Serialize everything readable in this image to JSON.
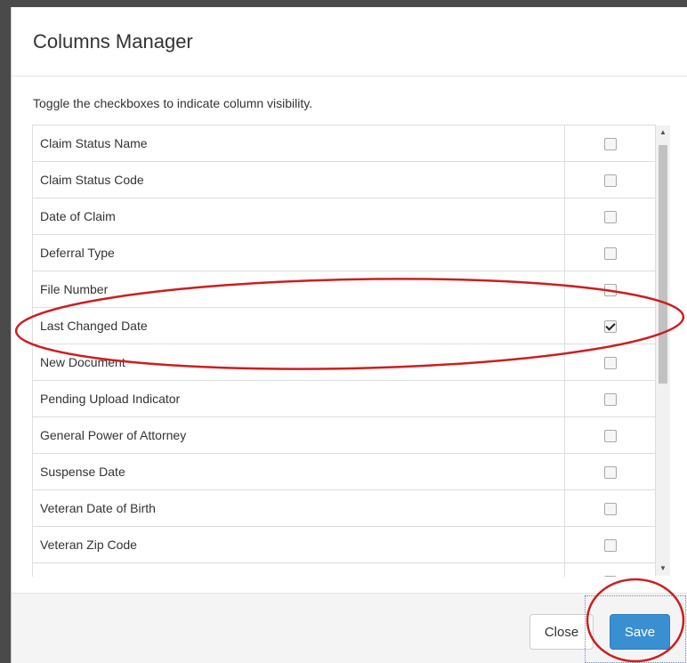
{
  "modal": {
    "title": "Columns Manager",
    "instructions": "Toggle the checkboxes to indicate column visibility."
  },
  "columns": [
    {
      "label": "Claim Status Name",
      "checked": false
    },
    {
      "label": "Claim Status Code",
      "checked": false
    },
    {
      "label": "Date of Claim",
      "checked": false
    },
    {
      "label": "Deferral Type",
      "checked": false
    },
    {
      "label": "File Number",
      "checked": false
    },
    {
      "label": "Last Changed Date",
      "checked": true
    },
    {
      "label": "New Document",
      "checked": false
    },
    {
      "label": "Pending Upload Indicator",
      "checked": false
    },
    {
      "label": "General Power of Attorney",
      "checked": false
    },
    {
      "label": "Suspense Date",
      "checked": false
    },
    {
      "label": "Veteran Date of Birth",
      "checked": false
    },
    {
      "label": "Veteran Zip Code",
      "checked": false
    },
    {
      "label": "",
      "checked": false
    }
  ],
  "footer": {
    "close_label": "Close",
    "save_label": "Save"
  },
  "icons": {
    "scroll_up": "scroll-up-arrow-icon",
    "scroll_down": "scroll-down-arrow-icon",
    "checkbox": "checkbox-icon"
  },
  "colors": {
    "primary": "#3a8fd0",
    "annotation": "#cc1f1f"
  }
}
